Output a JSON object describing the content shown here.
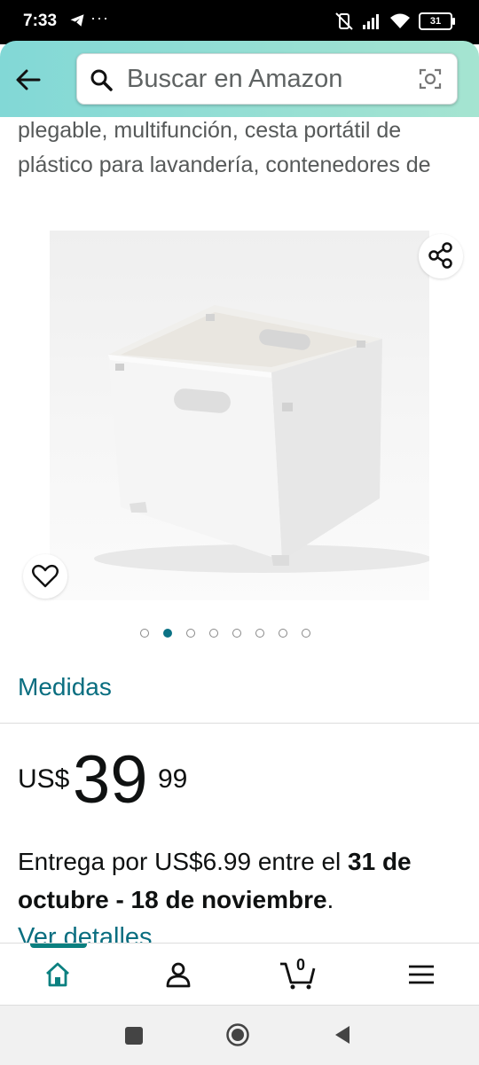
{
  "status_bar": {
    "time": "7:33",
    "dots": "···",
    "battery": "31"
  },
  "search": {
    "placeholder": "Buscar en Amazon"
  },
  "product": {
    "title": "plegable, multifunción, cesta portátil de plástico para lavandería, contenedores de",
    "image_alt": "Cesta plegable blanca",
    "carousel": {
      "count": 8,
      "active_index": 1
    },
    "medidas_label": "Medidas",
    "price": {
      "currency": "US$",
      "whole": "39",
      "fraction": "99"
    },
    "delivery": {
      "prefix": "Entrega por US$6.99 entre el ",
      "dates": "31 de octubre - 18 de noviembre",
      "suffix": ".",
      "details_link": "Ver detalles"
    }
  },
  "bottom_nav": {
    "items": [
      {
        "name": "home",
        "active": true
      },
      {
        "name": "account",
        "active": false
      },
      {
        "name": "cart",
        "count": "0",
        "active": false
      },
      {
        "name": "menu",
        "active": false
      }
    ]
  },
  "colors": {
    "accent": "#0a6e80",
    "header_start": "#82d8d6",
    "header_end": "#a5e4d1"
  }
}
